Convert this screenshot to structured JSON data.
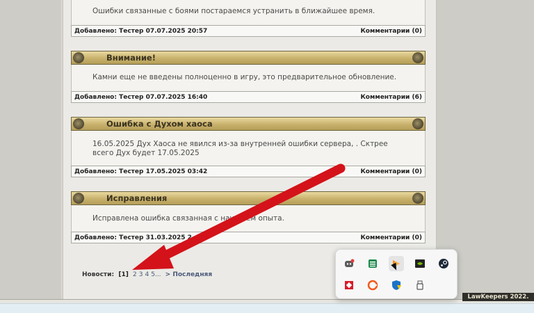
{
  "news": [
    {
      "title": "",
      "body": "Ошибки связанные с боями постараемся устранить в ближайшее время.",
      "added_label": "Добавлено:",
      "author": "Тестер",
      "datetime": "07.07.2025 20:57",
      "comments_label": "Комментарии",
      "comments_count": "(0)"
    },
    {
      "title": "Внимание!",
      "body": "Камни еще не введены полноценно в игру, это предварительное обновление.",
      "added_label": "Добавлено:",
      "author": "Тестер",
      "datetime": "07.07.2025 16:40",
      "comments_label": "Комментарии",
      "comments_count": "(6)"
    },
    {
      "title": "Ошибка с Духом хаоса",
      "body": "16.05.2025 Дух Хаоса не явился из-за внутренней ошибки сервера, . Cктрее всего Дух будет 17.05.2025",
      "added_label": "Добавлено:",
      "author": "Тестер",
      "datetime": "17.05.2025 03:42",
      "comments_label": "Комментарии",
      "comments_count": "(0)"
    },
    {
      "title": "Исправления",
      "body": "Исправлена ошибка связанная с начи     ием опыта.",
      "added_label": "Добавлено:",
      "author": "Тестер",
      "datetime": "31.03.2025 2",
      "comments_label": "Комментарии",
      "comments_count": "(0)"
    }
  ],
  "pager": {
    "label": "Новости:",
    "current": "[1]",
    "pages": [
      "2",
      "3",
      "4",
      "5..."
    ],
    "last": "> Последняя"
  },
  "copyright": "LawKeepers 2022.",
  "tray": {
    "icons": [
      "discord-icon",
      "sheets-icon",
      "app-icon",
      "nvidia-icon",
      "steam-icon",
      "anydesk-icon",
      "grammarly-icon",
      "defender-icon",
      "usb-icon"
    ]
  },
  "colors": {
    "header_gold": "#c8b16c",
    "arrow_red": "#d4121a"
  }
}
